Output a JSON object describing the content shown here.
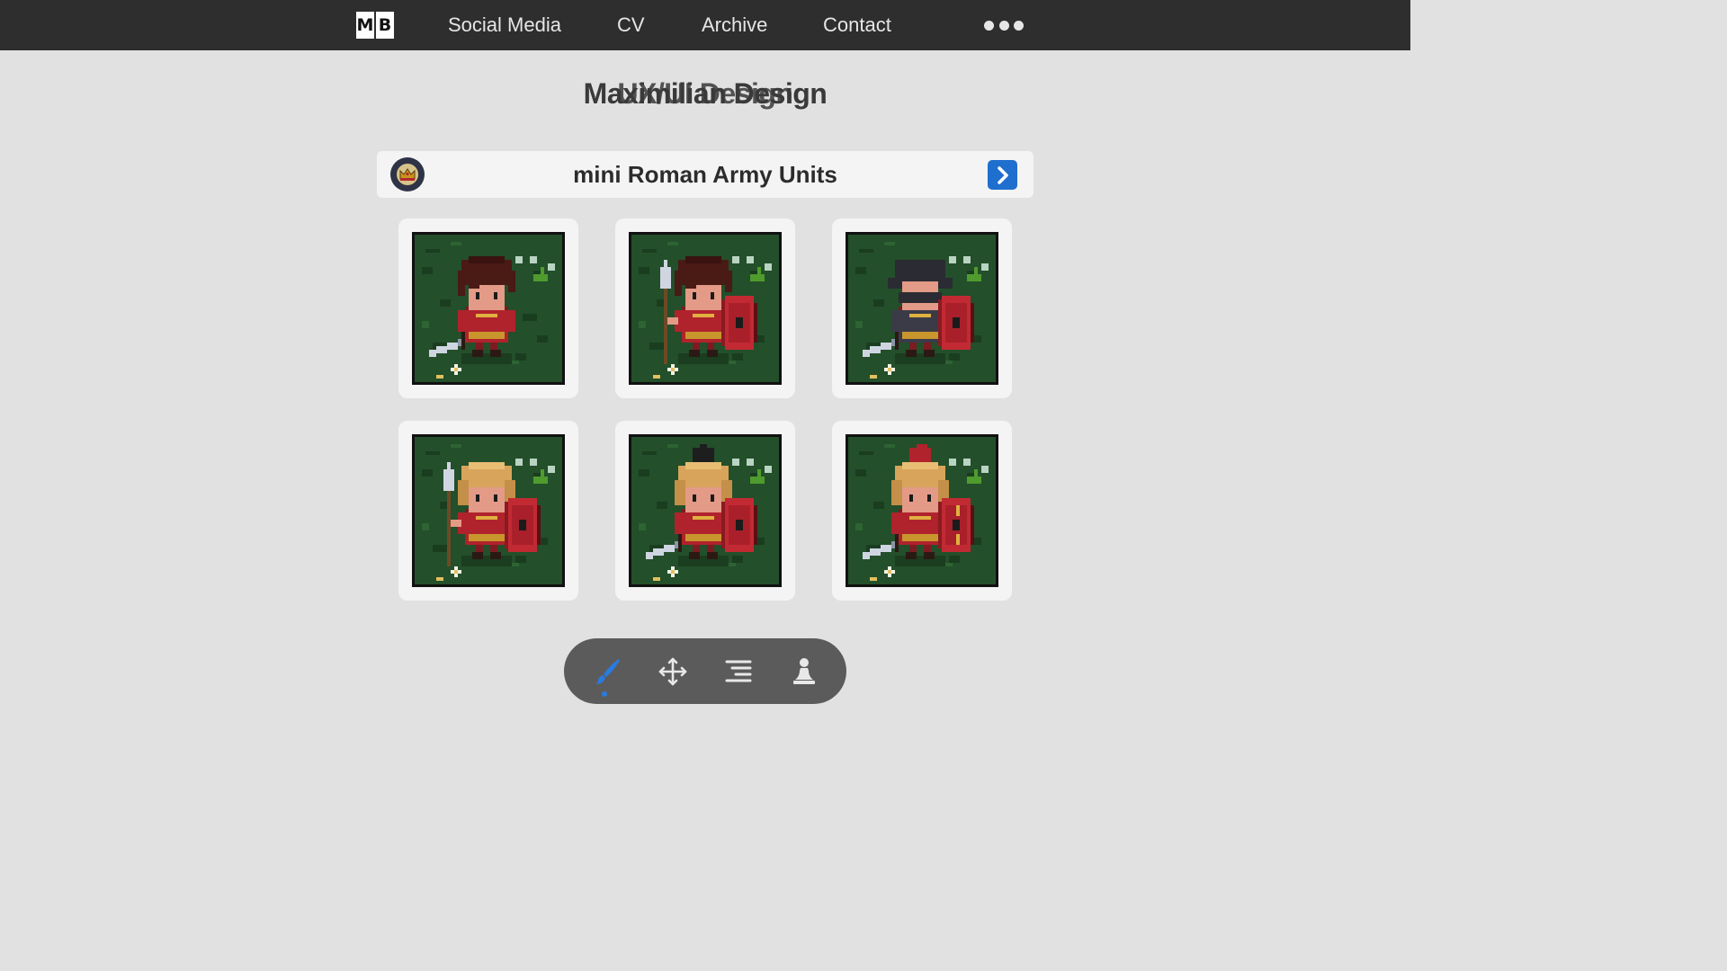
{
  "nav": {
    "logo_letters": [
      "M",
      "B"
    ],
    "links": [
      "Social Media",
      "CV",
      "Archive",
      "Contact"
    ],
    "more_icon": "ellipsis-icon"
  },
  "site_title": {
    "layer_a": "Maximilian Design",
    "layer_b": "UX/UI Design"
  },
  "section": {
    "title": "mini Roman Army Units",
    "badge_icon": "crown-icon",
    "next_icon": "chevron-right-icon"
  },
  "units": [
    {
      "helmet": "hair",
      "weapon": "sword",
      "shield": false
    },
    {
      "helmet": "hair",
      "weapon": "spear",
      "shield": true
    },
    {
      "helmet": "dark",
      "weapon": "sword",
      "shield": true
    },
    {
      "helmet": "gold",
      "weapon": "spear",
      "shield": true
    },
    {
      "helmet": "gold-black-crest",
      "weapon": "sword",
      "shield": true
    },
    {
      "helmet": "gold-red-crest",
      "weapon": "sword",
      "shield": true
    }
  ],
  "toolbar": {
    "tools": [
      "brush-icon",
      "move-icon",
      "align-right-icon",
      "pawn-icon"
    ],
    "active_tool": "brush-icon"
  },
  "colors": {
    "nav_bg": "#2e2e2e",
    "page_bg": "#e1e1e1",
    "accent": "#1f6fcf",
    "toolbar_bg": "#5b5b5b",
    "grass": "#234f2a",
    "tunic": "#b0232c"
  }
}
